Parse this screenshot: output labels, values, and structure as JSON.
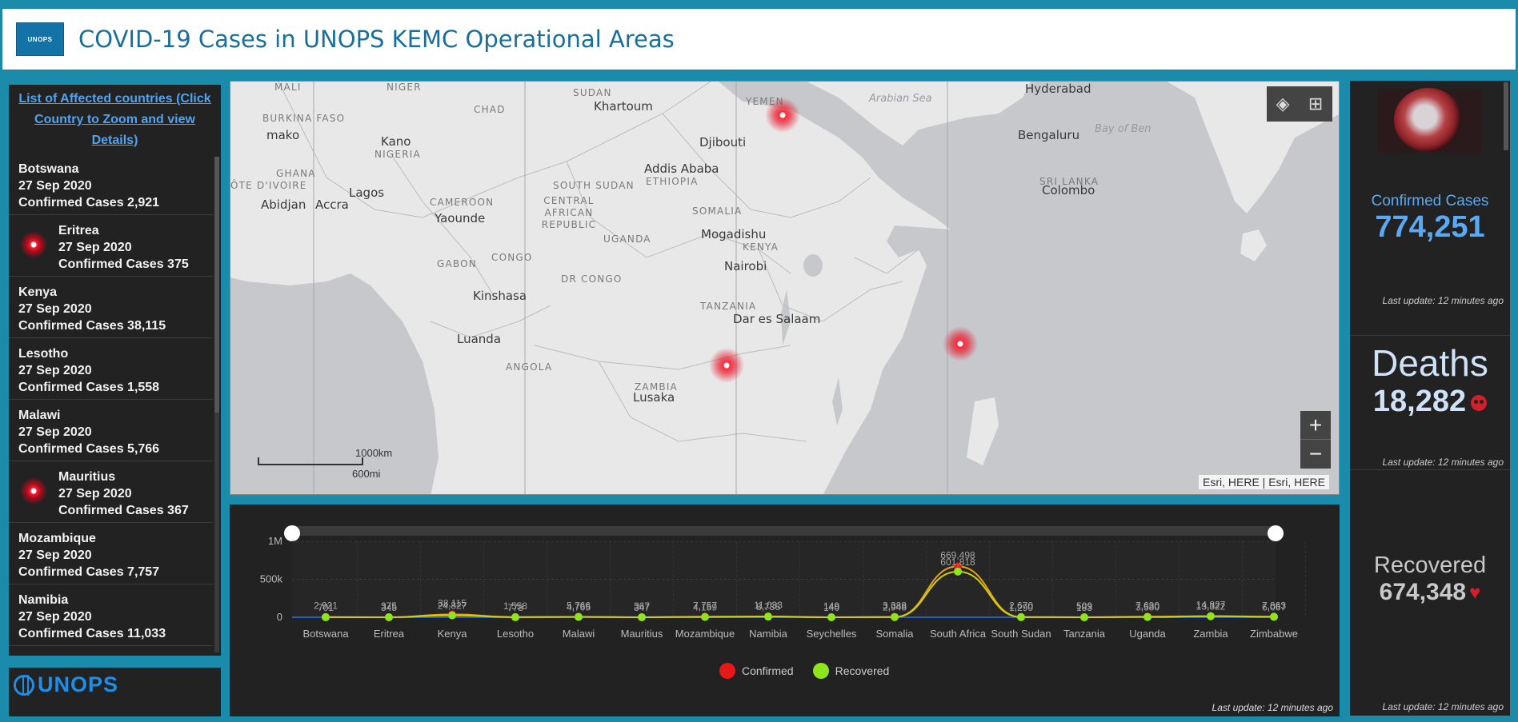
{
  "header": {
    "logo_text": "UNOPS",
    "title": "COVID-19 Cases in UNOPS KEMC Operational Areas"
  },
  "sidebar": {
    "header_link": "List of Affected countries (Click Country to Zoom and view Details)",
    "items": [
      {
        "country": "Botswana",
        "date": "27 Sep 2020",
        "cases": "Confirmed Cases 2,921",
        "marker": false
      },
      {
        "country": "Eritrea",
        "date": "27 Sep 2020",
        "cases": "Confirmed Cases 375",
        "marker": true
      },
      {
        "country": "Kenya",
        "date": "27 Sep 2020",
        "cases": "Confirmed Cases 38,115",
        "marker": false
      },
      {
        "country": "Lesotho",
        "date": "27 Sep 2020",
        "cases": "Confirmed Cases 1,558",
        "marker": false
      },
      {
        "country": "Malawi",
        "date": "27 Sep 2020",
        "cases": "Confirmed Cases 5,766",
        "marker": false
      },
      {
        "country": "Mauritius",
        "date": "27 Sep 2020",
        "cases": "Confirmed Cases 367",
        "marker": true
      },
      {
        "country": "Mozambique",
        "date": "27 Sep 2020",
        "cases": "Confirmed Cases 7,757",
        "marker": false
      },
      {
        "country": "Namibia",
        "date": "27 Sep 2020",
        "cases": "Confirmed Cases 11,033",
        "marker": false
      }
    ],
    "footer_logo": "UNOPS"
  },
  "map": {
    "labels": [
      {
        "text": "MALI",
        "kind": "region"
      },
      {
        "text": "NIGER",
        "kind": "region"
      },
      {
        "text": "SUDAN",
        "kind": "region"
      },
      {
        "text": "Khartoum",
        "kind": "city"
      },
      {
        "text": "YEMEN",
        "kind": "region"
      },
      {
        "text": "Arabian Sea",
        "kind": "sea"
      },
      {
        "text": "Hyderabad",
        "kind": "city"
      },
      {
        "text": "CHAD",
        "kind": "region"
      },
      {
        "text": "BURKINA FASO",
        "kind": "region"
      },
      {
        "text": "mako",
        "kind": "city"
      },
      {
        "text": "Djibouti",
        "kind": "city"
      },
      {
        "text": "Bengaluru",
        "kind": "city"
      },
      {
        "text": "Bay of Ben",
        "kind": "sea"
      },
      {
        "text": "Kano",
        "kind": "city"
      },
      {
        "text": "NIGERIA",
        "kind": "region"
      },
      {
        "text": "Addis Ababa",
        "kind": "city"
      },
      {
        "text": "ETHIOPIA",
        "kind": "region"
      },
      {
        "text": "GHANA",
        "kind": "region"
      },
      {
        "text": "CENTRAL AFRICAN REPUBLIC",
        "kind": "region"
      },
      {
        "text": "SOUTH SUDAN",
        "kind": "region"
      },
      {
        "text": "SRI LANKA",
        "kind": "region"
      },
      {
        "text": "Colombo",
        "kind": "city"
      },
      {
        "text": "ÔTE D'IVOIRE",
        "kind": "region"
      },
      {
        "text": "Lagos",
        "kind": "city"
      },
      {
        "text": "Abidjan",
        "kind": "city"
      },
      {
        "text": "Accra",
        "kind": "city"
      },
      {
        "text": "CAMEROON",
        "kind": "region"
      },
      {
        "text": "Yaounde",
        "kind": "city"
      },
      {
        "text": "SOMALIA",
        "kind": "region"
      },
      {
        "text": "Mogadishu",
        "kind": "city"
      },
      {
        "text": "UGANDA",
        "kind": "region"
      },
      {
        "text": "KENYA",
        "kind": "region"
      },
      {
        "text": "GABON",
        "kind": "region"
      },
      {
        "text": "CONGO",
        "kind": "region"
      },
      {
        "text": "Nairobi",
        "kind": "city"
      },
      {
        "text": "DR CONGO",
        "kind": "region"
      },
      {
        "text": "Kinshasa",
        "kind": "city"
      },
      {
        "text": "TANZANIA",
        "kind": "region"
      },
      {
        "text": "Dar es Salaam",
        "kind": "city"
      },
      {
        "text": "Luanda",
        "kind": "city"
      },
      {
        "text": "ANGOLA",
        "kind": "region"
      },
      {
        "text": "ZAMBIA",
        "kind": "region"
      },
      {
        "text": "Lusaka",
        "kind": "city"
      }
    ],
    "scale_km": "1000km",
    "scale_mi": "600mi",
    "attribution": "Esri, HERE | Esri, HERE",
    "zoom_in": "+",
    "zoom_out": "−"
  },
  "chart_data": {
    "type": "line",
    "categories": [
      "Botswana",
      "Eritrea",
      "Kenya",
      "Lesotho",
      "Malawi",
      "Mauritius",
      "Mozambique",
      "Namibia",
      "Seychelles",
      "Somalia",
      "South Africa",
      "South Sudan",
      "Tanzania",
      "Uganda",
      "Zambia",
      "Zimbabwe"
    ],
    "series": [
      {
        "name": "Confirmed",
        "color": "#e81818",
        "values": [
          2921,
          375,
          38115,
          1558,
          5766,
          367,
          7757,
          11033,
          149,
          3388,
          669498,
          2670,
          509,
          7630,
          14827,
          7863
        ]
      },
      {
        "name": "Recovered",
        "color": "#8fe51c",
        "values": [
          701,
          345,
          24827,
          778,
          4765,
          347,
          4159,
          8736,
          140,
          2948,
          601818,
          1290,
          183,
          3580,
          13322,
          6067
        ]
      }
    ],
    "data_labels": {
      "confirmed": [
        "2,921",
        "375",
        "38,115",
        "1,558",
        "5,766",
        "367",
        "7,757",
        "11,033",
        "149",
        "3,388",
        "669,498",
        "2,670",
        "509",
        "7,630",
        "14,827",
        "7,863"
      ],
      "recovered": [
        "701",
        "345",
        "24,827",
        "778",
        "4,765",
        "347",
        "4,159",
        "8,736",
        "140",
        "2,948",
        "601,818",
        "1,290",
        "183",
        "3,580",
        "13,322",
        "6,067"
      ]
    },
    "y_ticks": [
      "1M",
      "500k",
      "0"
    ],
    "ylim": [
      0,
      1000000
    ],
    "legend_position": "bottom"
  },
  "chart_panel": {
    "last_update": "Last update: 12 minutes ago"
  },
  "stats": {
    "confirmed": {
      "label": "Confirmed Cases",
      "value": "774,251",
      "update": "Last update: 12 minutes ago",
      "color": "#5aa9f5"
    },
    "deaths": {
      "label": "Deaths",
      "value": "18,282",
      "update": "Last update: 12 minutes ago",
      "color": "#cfe2f8"
    },
    "recovered": {
      "label": "Recovered",
      "value": "674,348",
      "update": "Last update: 12 minutes ago",
      "color": "#c8c8c8"
    }
  }
}
